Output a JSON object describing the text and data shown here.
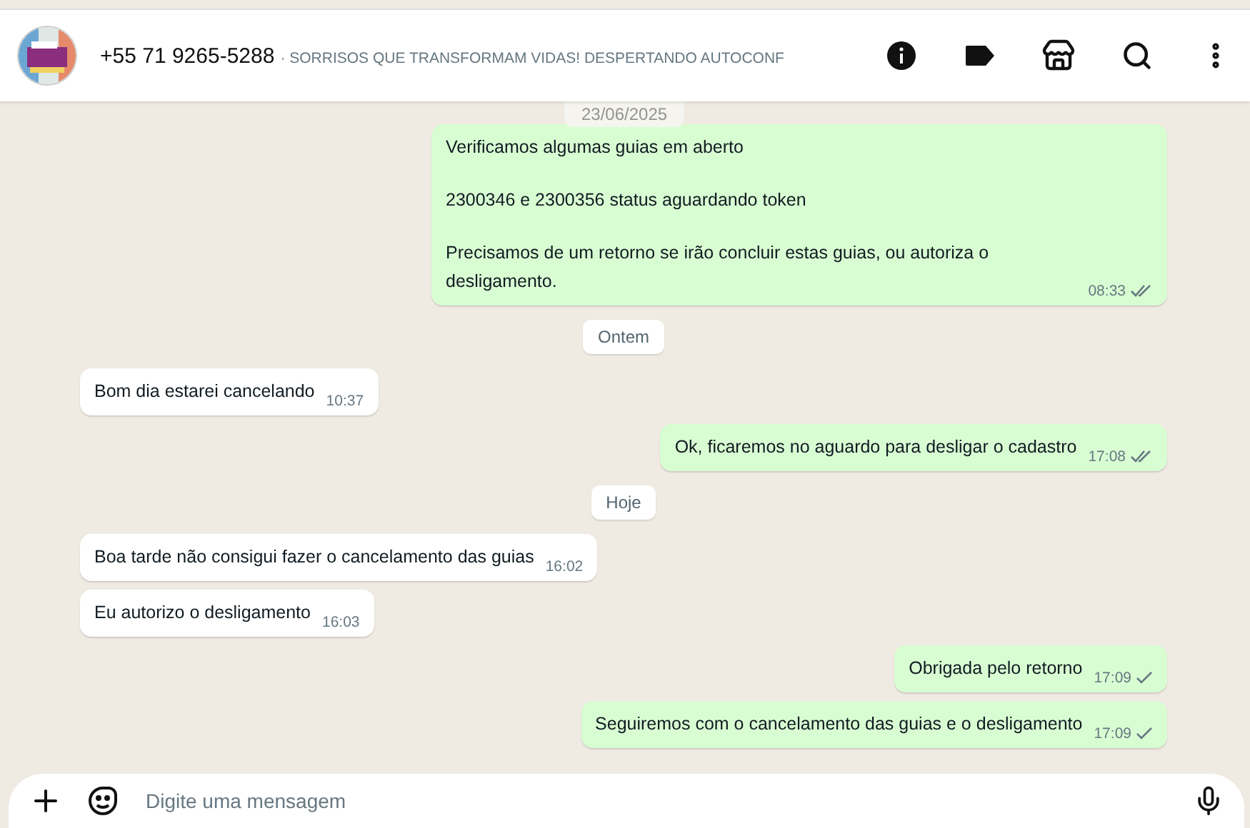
{
  "header": {
    "phone": "+55 71 9265-5288",
    "subtitle": "· SORRISOS QUE TRANSFORMAM VIDAS! DESPERTANDO AUTOCONF"
  },
  "sticky_date": "23/06/2025",
  "items": [
    {
      "kind": "message",
      "outgoing": true,
      "paragraphs": [
        "Verificamos algumas guias em aberto",
        "2300346 e 2300356 status aguardando token",
        "Precisamos de um retorno se irão concluir estas guias, ou autoriza o desligamento."
      ],
      "time": "08:33",
      "read": true
    },
    {
      "kind": "date",
      "label": "Ontem"
    },
    {
      "kind": "message",
      "outgoing": false,
      "paragraphs": [
        "Bom dia estarei cancelando"
      ],
      "time": "10:37"
    },
    {
      "kind": "message",
      "outgoing": true,
      "paragraphs": [
        "Ok, ficaremos no aguardo para desligar o cadastro"
      ],
      "time": "17:08",
      "read": true
    },
    {
      "kind": "date",
      "label": "Hoje"
    },
    {
      "kind": "message",
      "outgoing": false,
      "paragraphs": [
        "Boa tarde não consigui fazer o cancelamento  das guias"
      ],
      "time": "16:02"
    },
    {
      "kind": "message",
      "outgoing": false,
      "paragraphs": [
        "Eu autorizo o desligamento"
      ],
      "time": "16:03"
    },
    {
      "kind": "message",
      "outgoing": true,
      "paragraphs": [
        "Obrigada pelo retorno"
      ],
      "time": "17:09",
      "read": false
    },
    {
      "kind": "message",
      "outgoing": true,
      "paragraphs": [
        "Seguiremos com o cancelamento das guias e o desligamento"
      ],
      "time": "17:09",
      "read": false
    }
  ],
  "composer": {
    "placeholder": "Digite uma mensagem"
  }
}
